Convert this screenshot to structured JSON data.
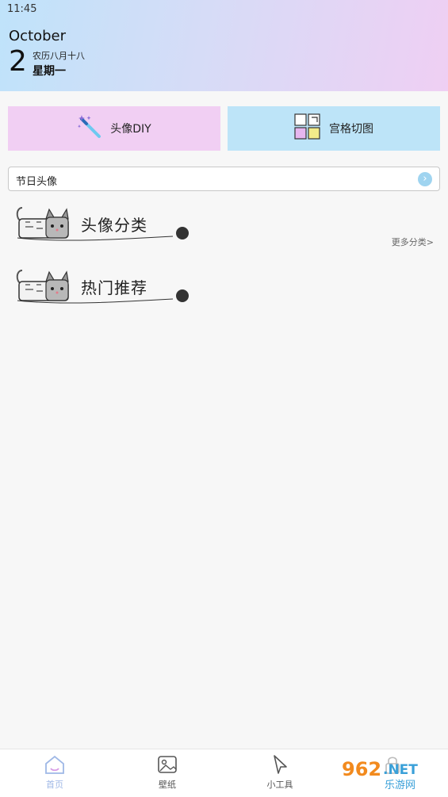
{
  "status_bar": {
    "time": "11:45"
  },
  "date": {
    "month": "October",
    "day": "2",
    "lunar": "农历八月十八",
    "weekday": "星期一"
  },
  "cards": [
    {
      "label": "头像DIY",
      "icon": "magic-wand-icon",
      "color": "#f1cff3"
    },
    {
      "label": "宫格切图",
      "icon": "grid-cut-icon",
      "color": "#bde4f8"
    }
  ],
  "search": {
    "text": "节日头像",
    "icon": "arrow-right-circle-icon"
  },
  "sections": [
    {
      "title": "头像分类",
      "more": "更多分类>"
    },
    {
      "title": "热门推荐"
    }
  ],
  "nav": {
    "items": [
      {
        "label": "首页",
        "icon": "home-icon",
        "active": true
      },
      {
        "label": "壁纸",
        "icon": "wallpaper-icon",
        "active": false
      },
      {
        "label": "小工具",
        "icon": "cursor-icon",
        "active": false
      },
      {
        "label": "",
        "icon": "lock-icon",
        "active": false
      }
    ]
  },
  "watermark": {
    "text1": "962",
    "text2": ".NET",
    "text3": "乐游网"
  },
  "colors": {
    "accent": "#9fb8e6",
    "pink": "#f1cff3",
    "blue": "#bde4f8"
  }
}
